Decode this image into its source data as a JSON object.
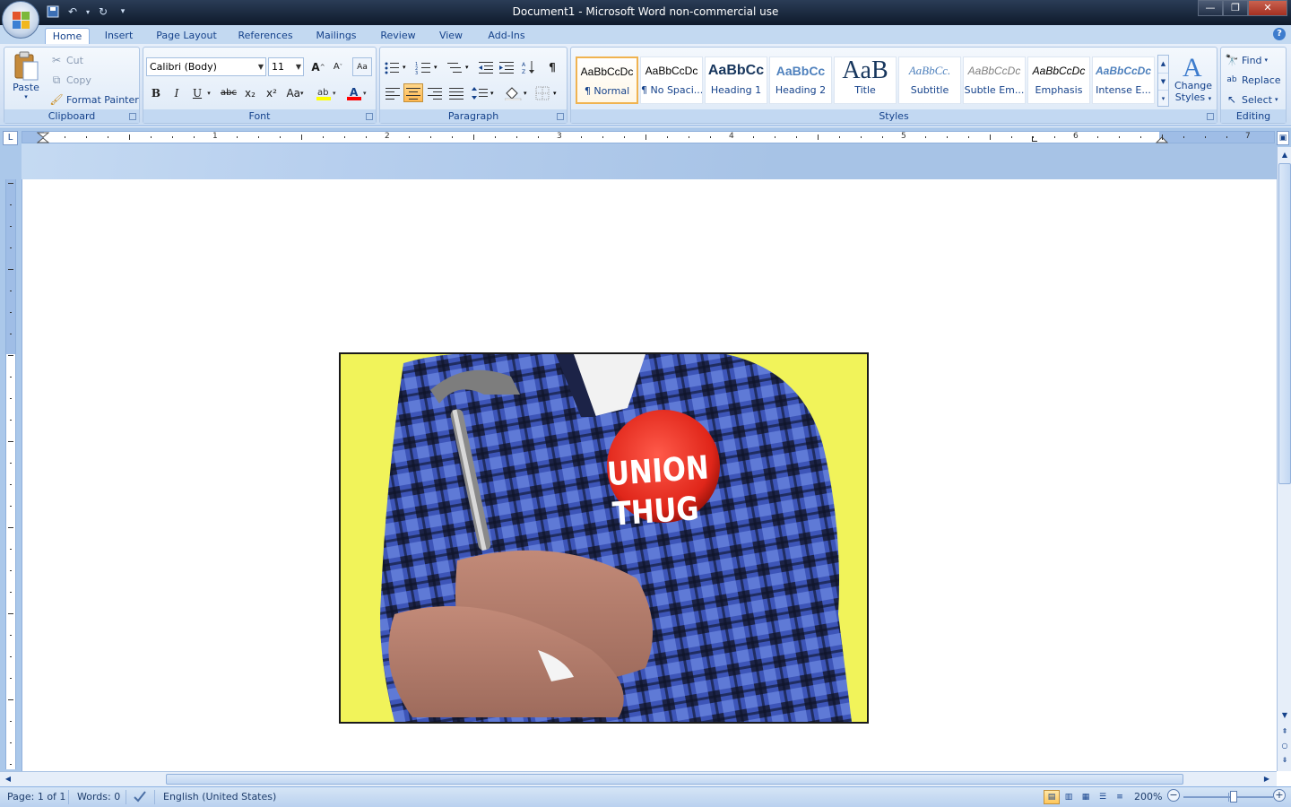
{
  "window": {
    "title": "Document1 - Microsoft Word non-commercial use",
    "controls": [
      "minimize",
      "restore",
      "close"
    ]
  },
  "tabs": [
    {
      "label": "Home",
      "active": true
    },
    {
      "label": "Insert"
    },
    {
      "label": "Page Layout"
    },
    {
      "label": "References"
    },
    {
      "label": "Mailings"
    },
    {
      "label": "Review"
    },
    {
      "label": "View"
    },
    {
      "label": "Add-Ins"
    }
  ],
  "clipboard": {
    "label": "Clipboard",
    "paste": "Paste",
    "cut": "Cut",
    "copy": "Copy",
    "format_painter": "Format Painter"
  },
  "font": {
    "label": "Font",
    "family": "Calibri (Body)",
    "size": "11",
    "bold": "B",
    "italic": "I",
    "underline": "U",
    "strike": "abc",
    "sub": "x₂",
    "sup": "x²",
    "change_case": "Aa"
  },
  "paragraph": {
    "label": "Paragraph",
    "show_marks": "¶",
    "alignment": "center"
  },
  "styles": {
    "label": "Styles",
    "items": [
      {
        "sample": "AaBbCcDc",
        "name": "¶ Normal",
        "selected": true
      },
      {
        "sample": "AaBbCcDc",
        "name": "¶ No Spaci..."
      },
      {
        "sample": "AaBbCc",
        "name": "Heading 1"
      },
      {
        "sample": "AaBbCc",
        "name": "Heading 2"
      },
      {
        "sample": "AaB",
        "name": "Title"
      },
      {
        "sample": "AaBbCc.",
        "name": "Subtitle"
      },
      {
        "sample": "AaBbCcDc",
        "name": "Subtle Em..."
      },
      {
        "sample": "AaBbCcDc",
        "name": "Emphasis"
      },
      {
        "sample": "AaBbCcDc",
        "name": "Intense E..."
      }
    ],
    "change_styles": [
      "Change",
      "Styles"
    ]
  },
  "editing": {
    "label": "Editing",
    "find": "Find",
    "replace": "Replace",
    "select": "Select"
  },
  "ruler": {
    "numbers": [
      "1",
      "2",
      "3",
      "4",
      "5",
      "6",
      "7"
    ],
    "tab_selector": "L"
  },
  "picture": {
    "button_text_1": "UNION",
    "button_text_2": "THUG",
    "background": "#f1f35a"
  },
  "status": {
    "page": "Page: 1 of 1",
    "words": "Words: 0",
    "language": "English (United States)",
    "zoom": "200%"
  },
  "colors": {
    "ribbon_blue": "#c3d9f1",
    "title_dark": "#1b2a40",
    "text_blue": "#15428b",
    "highlight_yellow": "#ffff00",
    "font_color_red": "#ff0000"
  }
}
